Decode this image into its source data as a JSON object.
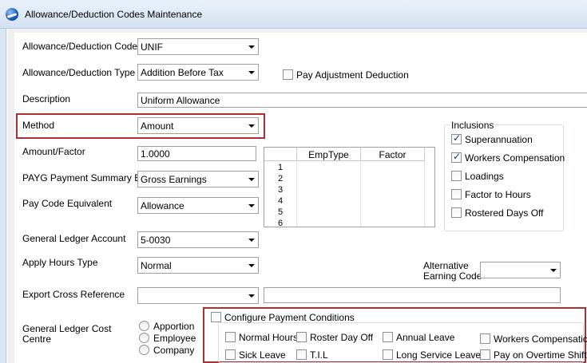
{
  "window": {
    "title": "Allowance/Deduction Codes Maintenance"
  },
  "form": {
    "code_label": "Allowance/Deduction Code",
    "code_value": "UNIF",
    "type_label": "Allowance/Deduction Type",
    "type_value": "Addition Before Tax",
    "pay_adjustment_label": "Pay Adjustment Deduction",
    "pay_adjustment_checked": false,
    "description_label": "Description",
    "description_value": "Uniform Allowance",
    "method_label": "Method",
    "method_value": "Amount",
    "amount_label": "Amount/Factor",
    "amount_value": "1.0000",
    "payg_label": "PAYG Payment Summary Box",
    "payg_value": "Gross Earnings",
    "pay_code_label": "Pay Code Equivalent",
    "pay_code_value": "Allowance",
    "gl_account_label": "General Ledger Account",
    "gl_account_value": "5-0030",
    "hours_type_label": "Apply Hours Type",
    "hours_type_value": "Normal",
    "alt_earning_label_1": "Alternative",
    "alt_earning_label_2": "Earning Code",
    "alt_earning_value": "",
    "export_label": "Export Cross Reference",
    "export_value": "",
    "export_text_value": "",
    "gl_centre_label_1": "General Ledger Cost",
    "gl_centre_label_2": "Centre"
  },
  "cost_centre_options": [
    "Apportion",
    "Employee",
    "Company"
  ],
  "grid": {
    "headers": [
      "EmpType",
      "Factor"
    ],
    "row_numbers": [
      "1",
      "2",
      "3",
      "4",
      "5",
      "6"
    ]
  },
  "inclusions": {
    "title": "Inclusions",
    "items": [
      {
        "label": "Superannuation",
        "checked": true
      },
      {
        "label": "Workers Compensation",
        "checked": true
      },
      {
        "label": "Loadings",
        "checked": false
      },
      {
        "label": "Factor to Hours",
        "checked": false
      },
      {
        "label": "Rostered Days Off",
        "checked": false
      }
    ]
  },
  "payment_conditions": {
    "title": "Configure Payment Conditions",
    "checked": false,
    "items": [
      {
        "label": "Normal Hours",
        "checked": false
      },
      {
        "label": "Roster Day Off",
        "checked": false
      },
      {
        "label": "Annual Leave",
        "checked": false
      },
      {
        "label": "Workers Compensation",
        "checked": false
      },
      {
        "label": "Sick Leave",
        "checked": false
      },
      {
        "label": "T.I.L",
        "checked": false
      },
      {
        "label": "Long Service Leave",
        "checked": false
      },
      {
        "label": "Pay on Overtime Shifts",
        "checked": false
      }
    ]
  },
  "colors": {
    "highlight_border": "#b22d2d",
    "title_bar": "#d3e1f2",
    "panel_background": "#f0f0f0"
  }
}
